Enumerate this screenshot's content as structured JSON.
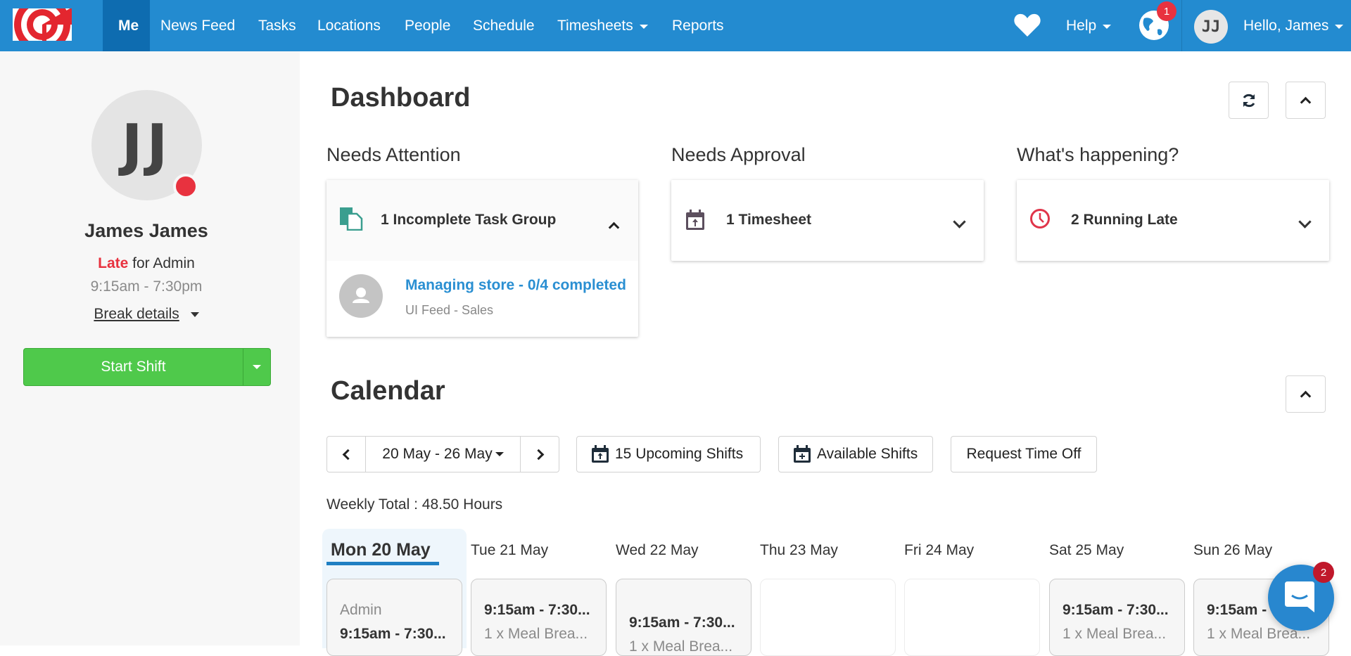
{
  "nav": {
    "items": [
      {
        "label": "Me",
        "active": true
      },
      {
        "label": "News Feed"
      },
      {
        "label": "Tasks"
      },
      {
        "label": "Locations"
      },
      {
        "label": "People"
      },
      {
        "label": "Schedule"
      },
      {
        "label": "Timesheets",
        "dropdown": true
      },
      {
        "label": "Reports"
      }
    ],
    "help_label": "Help",
    "notification_count": "1",
    "user_initials": "JJ",
    "greeting": "Hello, James",
    "brand_color": "#238bd0"
  },
  "sidebar": {
    "initials": "JJ",
    "name": "James James",
    "status_word": "Late",
    "status_rest": " for Admin",
    "shift_time": "9:15am - 7:30pm",
    "break_details": "Break details",
    "start_shift": "Start Shift",
    "status_color": "#e8323f",
    "button_color": "#4fc94b"
  },
  "dashboard": {
    "title": "Dashboard",
    "sections": [
      {
        "heading": "Needs Attention",
        "card_title": "1 Incomplete Task Group",
        "icon": "task-group-icon",
        "expanded": true,
        "items": [
          {
            "title": "Managing store - 0/4 completed",
            "subtitle": "UI Feed - Sales"
          }
        ]
      },
      {
        "heading": "Needs Approval",
        "card_title": "1 Timesheet",
        "icon": "calendar-upload-icon",
        "expanded": false
      },
      {
        "heading": "What's happening?",
        "card_title": "2 Running Late",
        "icon": "clock-icon",
        "expanded": false
      }
    ]
  },
  "calendar": {
    "title": "Calendar",
    "date_range": "20 May - 26 May",
    "upcoming_shifts": "15 Upcoming Shifts",
    "available_shifts": "Available Shifts",
    "request_time_off": "Request Time Off",
    "weekly_total": "Weekly Total : 48.50 Hours",
    "days": [
      {
        "label": "Mon 20 May",
        "today": true,
        "role": "Admin",
        "time": "9:15am - 7:30...",
        "break": ""
      },
      {
        "label": "Tue 21 May",
        "time": "9:15am - 7:30...",
        "break": "1 x Meal Brea..."
      },
      {
        "label": "Wed 22 May",
        "time": "9:15am - 7:30...",
        "break": "1 x Meal Brea..."
      },
      {
        "label": "Thu 23 May",
        "time": "",
        "break": ""
      },
      {
        "label": "Fri 24 May",
        "time": "",
        "break": ""
      },
      {
        "label": "Sat 25 May",
        "time": "9:15am - 7:30...",
        "break": "1 x Meal Brea..."
      },
      {
        "label": "Sun 26 May",
        "time": "9:15am - 7:30...",
        "break": "1 x Meal Brea..."
      }
    ]
  },
  "chat": {
    "unread_count": "2"
  }
}
